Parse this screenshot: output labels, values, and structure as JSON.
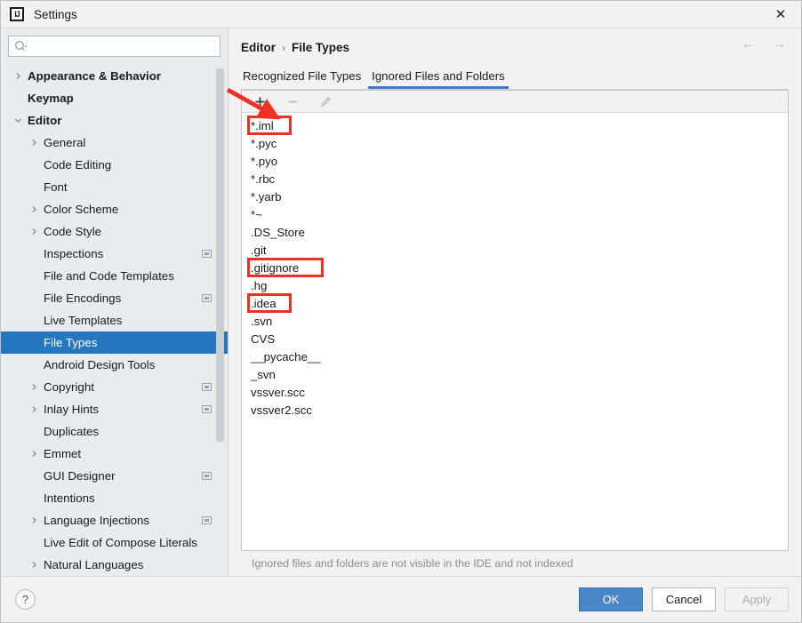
{
  "window": {
    "title": "Settings",
    "logo_text": "IJ",
    "close_label": "✕"
  },
  "search": {
    "value": "",
    "placeholder": ""
  },
  "sidebar": {
    "items": [
      {
        "label": "Appearance & Behavior",
        "level": 0,
        "chevron": "right",
        "badge": false,
        "selected": false
      },
      {
        "label": "Keymap",
        "level": 0,
        "chevron": "none",
        "badge": false,
        "selected": false
      },
      {
        "label": "Editor",
        "level": 0,
        "chevron": "down",
        "badge": false,
        "selected": false
      },
      {
        "label": "General",
        "level": 1,
        "chevron": "right",
        "badge": false,
        "selected": false
      },
      {
        "label": "Code Editing",
        "level": 1,
        "chevron": "none",
        "badge": false,
        "selected": false
      },
      {
        "label": "Font",
        "level": 1,
        "chevron": "none",
        "badge": false,
        "selected": false
      },
      {
        "label": "Color Scheme",
        "level": 1,
        "chevron": "right",
        "badge": false,
        "selected": false
      },
      {
        "label": "Code Style",
        "level": 1,
        "chevron": "right",
        "badge": false,
        "selected": false
      },
      {
        "label": "Inspections",
        "level": 1,
        "chevron": "none",
        "badge": true,
        "selected": false
      },
      {
        "label": "File and Code Templates",
        "level": 1,
        "chevron": "none",
        "badge": false,
        "selected": false
      },
      {
        "label": "File Encodings",
        "level": 1,
        "chevron": "none",
        "badge": true,
        "selected": false
      },
      {
        "label": "Live Templates",
        "level": 1,
        "chevron": "none",
        "badge": false,
        "selected": false
      },
      {
        "label": "File Types",
        "level": 1,
        "chevron": "none",
        "badge": false,
        "selected": true
      },
      {
        "label": "Android Design Tools",
        "level": 1,
        "chevron": "none",
        "badge": false,
        "selected": false
      },
      {
        "label": "Copyright",
        "level": 1,
        "chevron": "right",
        "badge": true,
        "selected": false
      },
      {
        "label": "Inlay Hints",
        "level": 1,
        "chevron": "right",
        "badge": true,
        "selected": false
      },
      {
        "label": "Duplicates",
        "level": 1,
        "chevron": "none",
        "badge": false,
        "selected": false
      },
      {
        "label": "Emmet",
        "level": 1,
        "chevron": "right",
        "badge": false,
        "selected": false
      },
      {
        "label": "GUI Designer",
        "level": 1,
        "chevron": "none",
        "badge": true,
        "selected": false
      },
      {
        "label": "Intentions",
        "level": 1,
        "chevron": "none",
        "badge": false,
        "selected": false
      },
      {
        "label": "Language Injections",
        "level": 1,
        "chevron": "right",
        "badge": true,
        "selected": false
      },
      {
        "label": "Live Edit of Compose Literals",
        "level": 1,
        "chevron": "none",
        "badge": false,
        "selected": false
      },
      {
        "label": "Natural Languages",
        "level": 1,
        "chevron": "right",
        "badge": false,
        "selected": false
      }
    ]
  },
  "breadcrumb": {
    "parent": "Editor",
    "separator": "›",
    "current": "File Types"
  },
  "nav": {
    "back": "←",
    "forward": "→"
  },
  "tabs": [
    {
      "label": "Recognized File Types",
      "active": false
    },
    {
      "label": "Ignored Files and Folders",
      "active": true
    }
  ],
  "toolbar": {
    "add_label": "+",
    "remove_label": "−",
    "edit_label": "pencil",
    "add_enabled": true,
    "remove_enabled": false,
    "edit_enabled": false
  },
  "ignored_list": [
    {
      "value": "*.iml",
      "highlighted": true
    },
    {
      "value": "*.pyc",
      "highlighted": false
    },
    {
      "value": "*.pyo",
      "highlighted": false
    },
    {
      "value": "*.rbc",
      "highlighted": false
    },
    {
      "value": "*.yarb",
      "highlighted": false
    },
    {
      "value": "*~",
      "highlighted": false
    },
    {
      "value": ".DS_Store",
      "highlighted": false
    },
    {
      "value": ".git",
      "highlighted": false
    },
    {
      "value": ".gitignore",
      "highlighted": true
    },
    {
      "value": ".hg",
      "highlighted": false
    },
    {
      "value": ".idea",
      "highlighted": true
    },
    {
      "value": ".svn",
      "highlighted": false
    },
    {
      "value": "CVS",
      "highlighted": false
    },
    {
      "value": "__pycache__",
      "highlighted": false
    },
    {
      "value": "_svn",
      "highlighted": false
    },
    {
      "value": "vssver.scc",
      "highlighted": false
    },
    {
      "value": "vssver2.scc",
      "highlighted": false
    }
  ],
  "hint": "Ignored files and folders are not visible in the IDE and not indexed",
  "footer": {
    "help_label": "?",
    "ok_label": "OK",
    "cancel_label": "Cancel",
    "apply_label": "Apply",
    "apply_enabled": false
  },
  "colors": {
    "accent": "#2675bf",
    "tab_underline": "#3879d9",
    "primary_button": "#4a86c8",
    "annotation": "#ee3124",
    "sidebar_bg": "#e8ecef",
    "panel_bg": "#f2f2f2"
  }
}
